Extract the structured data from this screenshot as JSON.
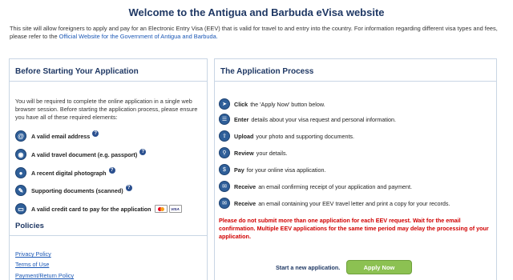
{
  "page": {
    "title": "Welcome to the Antigua and Barbuda eVisa website",
    "intro_text": "This site will allow foreigners to apply and pay for an Electronic Entry Visa (EEV) that is valid for travel to and entry into the country. For information regarding different visa types and fees, please refer to the",
    "intro_link": "Official Website for the Government of Antigua and Barbuda."
  },
  "before": {
    "heading": "Before Starting Your Application",
    "lead": "You will be required to complete the online application in a single web browser session. Before starting the application process, please ensure you have all of these required elements:",
    "items": [
      {
        "label": "A valid email address",
        "icon": "at-icon"
      },
      {
        "label": "A valid travel document (e.g. passport)",
        "icon": "passport-icon"
      },
      {
        "label": "A recent digital photograph",
        "icon": "person-icon"
      },
      {
        "label": "Supporting documents (scanned)",
        "icon": "clip-icon"
      },
      {
        "label": "A valid credit card to pay for the application",
        "icon": "card-icon"
      }
    ],
    "card_visa": "VISA"
  },
  "policies": {
    "heading": "Policies",
    "links": [
      "Privacy Policy",
      "Terms of Use",
      "Payment/Return Policy"
    ]
  },
  "process": {
    "heading": "The Application Process",
    "steps": [
      {
        "bold": "Click",
        "text": "the 'Apply Now' button below.",
        "icon": "cursor-icon"
      },
      {
        "bold": "Enter",
        "text": "details about your visa request and personal information.",
        "icon": "form-icon"
      },
      {
        "bold": "Upload",
        "text": "your photo and supporting documents.",
        "icon": "upload-icon"
      },
      {
        "bold": "Review",
        "text": "your details.",
        "icon": "review-icon"
      },
      {
        "bold": "Pay",
        "text": "for your online visa application.",
        "icon": "pay-icon"
      },
      {
        "bold": "Receive",
        "text": "an email confirming receipt of your application and payment.",
        "icon": "mail-icon"
      },
      {
        "bold": "Receive",
        "text": "an email containing your EEV travel letter and print a copy for your records.",
        "icon": "mail-icon"
      }
    ],
    "warning": "Please do not submit more than one application for each EEV request. Wait for the email confirmation. Multiple EEV applications for the same time period may delay the processing of your application.",
    "start_label": "Start a new application.",
    "apply_label": "Apply Now"
  },
  "colors": {
    "heading": "#1f3864",
    "link": "#1a57b5",
    "warning": "#d10000",
    "apply_button": "#8cc152"
  }
}
